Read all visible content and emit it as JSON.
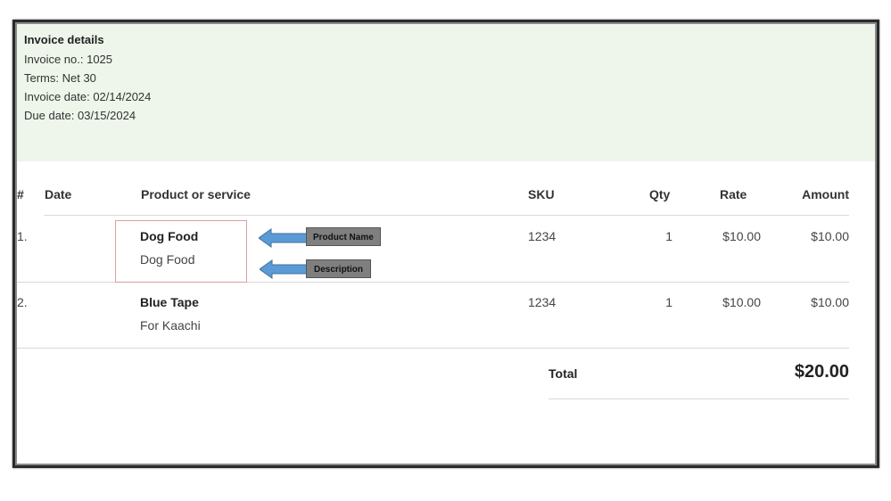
{
  "invoice": {
    "title": "Invoice details",
    "number_line": "Invoice no.: 1025",
    "terms_line": "Terms: Net 30",
    "invoice_date_line": "Invoice date: 02/14/2024",
    "due_date_line": "Due date: 03/15/2024"
  },
  "table": {
    "headers": {
      "num": "#",
      "date": "Date",
      "product": "Product or service",
      "sku": "SKU",
      "qty": "Qty",
      "rate": "Rate",
      "amount": "Amount"
    },
    "rows": [
      {
        "num": "1.",
        "name": "Dog Food",
        "description": "Dog Food",
        "sku": "1234",
        "qty": "1",
        "rate": "$10.00",
        "amount": "$10.00"
      },
      {
        "num": "2.",
        "name": "Blue Tape",
        "description": "For Kaachi",
        "sku": "1234",
        "qty": "1",
        "rate": "$10.00",
        "amount": "$10.00"
      }
    ],
    "total_label": "Total",
    "total_value": "$20.00"
  },
  "annotations": {
    "product_name_label": "Product Name",
    "description_label": "Description",
    "arrow_color": "#5b9bd5",
    "highlight_color": "#d9a1a1"
  }
}
